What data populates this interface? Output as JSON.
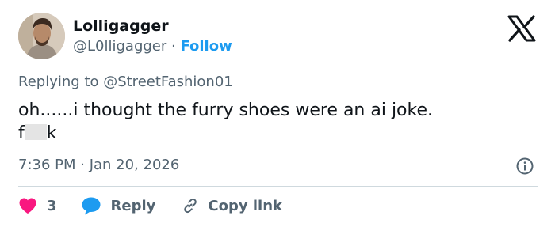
{
  "user": {
    "display_name": "Lolligagger",
    "handle": "@L0lligagger",
    "separator": " · ",
    "follow_label": "Follow"
  },
  "reply_to": "Replying to @StreetFashion01",
  "tweet": {
    "line1": "oh......i thought the furry shoes were an ai joke.",
    "censored_start": "f",
    "censored_end": "k"
  },
  "timestamp": "7:36 PM · Jan 20, 2026",
  "actions": {
    "like_count": "3",
    "reply_label": "Reply",
    "copy_label": "Copy link"
  },
  "colors": {
    "like": "#f91880",
    "reply": "#1d9bf0",
    "follow": "#1d9bf0",
    "secondary_text": "#536471"
  },
  "icons": [
    "x-logo-icon",
    "heart-icon",
    "speech-bubble-icon",
    "link-icon",
    "info-icon"
  ]
}
